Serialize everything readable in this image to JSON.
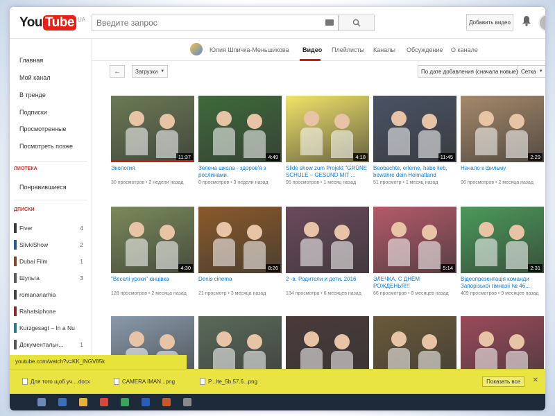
{
  "header": {
    "logo_you": "You",
    "logo_tube": "Tube",
    "logo_region": "UA",
    "search_placeholder": "Введите запрос",
    "upload_label": "Добавить видео"
  },
  "sidebar": {
    "items": [
      {
        "label": "Главная"
      },
      {
        "label": "Мой канал"
      },
      {
        "label": "В тренде"
      },
      {
        "label": "Подписки"
      },
      {
        "label": "Просмотренные"
      },
      {
        "label": "Посмотреть позже"
      }
    ],
    "library_heading": "ЛИОТЕКА",
    "library_items": [
      {
        "label": "Понравившиеся"
      }
    ],
    "subs_heading": "ДПИСКИ",
    "subscriptions": [
      {
        "name": "Fiver",
        "count": "4",
        "color": "#3a3a3a"
      },
      {
        "name": "SlivkiShow",
        "count": "2",
        "color": "#2a5d8f"
      },
      {
        "name": "Dubai Film",
        "count": "1",
        "color": "#7a4a2a"
      },
      {
        "name": "Шульга",
        "count": "3",
        "color": "#5a5a5a"
      },
      {
        "name": "romananarhia",
        "count": "",
        "color": "#444"
      },
      {
        "name": "Rahatsiphone",
        "count": "",
        "color": "#8a2a2a"
      },
      {
        "name": "Kurzgesagt – In a Nut...",
        "count": "",
        "color": "#2a7a8a"
      },
      {
        "name": "Документальн...",
        "count": "1",
        "color": "#555"
      }
    ]
  },
  "channel_nav": {
    "channel_name": "Юлия Шпичка-Меньшикова",
    "tabs": [
      {
        "label": "Видео",
        "active": true
      },
      {
        "label": "Плейлисты",
        "active": false
      },
      {
        "label": "Каналы",
        "active": false
      },
      {
        "label": "Обсуждение",
        "active": false
      },
      {
        "label": "О канале",
        "active": false
      }
    ]
  },
  "toolbar": {
    "uploads_label": "Загрузки",
    "sort_label": "По дате добавления (сначала новые)",
    "view_label": "Сетка"
  },
  "videos": [
    {
      "title": "Экология",
      "views": "30 просмотров",
      "age": "2 недели назад",
      "duration": "11:37",
      "bg": "#6b7a55",
      "watched": true
    },
    {
      "title": "Зелена школа - здоров'я з рослинами.",
      "views": "8 просмотров",
      "age": "3 недели назад",
      "duration": "4:49",
      "bg": "#3e6a3a",
      "watched": false
    },
    {
      "title": "Slide show zum Projekt \"GRÜNE SCHULE – GESUND MIT ...",
      "views": "95 просмотров",
      "age": "1 месяц назад",
      "duration": "4:18",
      "bg": "#f1e36a",
      "watched": false
    },
    {
      "title": "Beobachte, erlerne, habe lieb, bewahre dein Heimatland",
      "views": "51 просмотр",
      "age": "1 месяц назад",
      "duration": "11:45",
      "bg": "#4a5364",
      "watched": false
    },
    {
      "title": "Начало к фильму",
      "views": "96 просмотров",
      "age": "2 месяца назад",
      "duration": "2:29",
      "bg": "#a5896a",
      "watched": false
    },
    {
      "title": "\"Веселі уроки\" кінцівка",
      "views": "128 просмотров",
      "age": "2 месяца назад",
      "duration": "4:30",
      "bg": "#7a8a5a",
      "watched": false
    },
    {
      "title": "Denis cinema",
      "views": "21 просмотр",
      "age": "3 месяца назад",
      "duration": "8:26",
      "bg": "#8a5a2a",
      "watched": false
    },
    {
      "title": "2 -в. Родители и дети. 2016",
      "views": "134 просмотра",
      "age": "6 месяцев назад",
      "duration": "",
      "bg": "#6a4a5a",
      "watched": false
    },
    {
      "title": "ЭЛЕЧКА, С ДНЁМ РОЖДЕНЬЯ!!!",
      "views": "66 просмотров",
      "age": "8 месяцев назад",
      "duration": "5:14",
      "bg": "#b55a6a",
      "watched": false
    },
    {
      "title": "Відеопрезентація команди Запорізької гімназії № 46...",
      "views": "409 просмотров",
      "age": "9 месяцев назад",
      "duration": "2:31",
      "bg": "#4a9a5a",
      "watched": false
    },
    {
      "title": "",
      "views": "",
      "age": "",
      "duration": "",
      "bg": "#8a9aaa",
      "watched": false
    },
    {
      "title": "",
      "views": "",
      "age": "",
      "duration": "",
      "bg": "#5a6a5a",
      "watched": false
    },
    {
      "title": "",
      "views": "",
      "age": "",
      "duration": "",
      "bg": "#4a3a3a",
      "watched": false
    },
    {
      "title": "",
      "views": "",
      "age": "",
      "duration": "",
      "bg": "#6a5a3a",
      "watched": false
    },
    {
      "title": "",
      "views": "",
      "age": "",
      "duration": "",
      "bg": "#9a4a5a",
      "watched": false
    }
  ],
  "status_url": "youtube.com/watch?v=KK_lNGV85k",
  "downloads": {
    "items": [
      {
        "label": "Для того щоб уч....docx"
      },
      {
        "label": "CAMERA IMAN...png"
      },
      {
        "label": "P...Ite_5b.57.6...png"
      }
    ],
    "show_all": "Показать все"
  },
  "colors": {
    "accent": "#cc181e",
    "link": "#167ac6",
    "download_bar": "#e9e442"
  }
}
